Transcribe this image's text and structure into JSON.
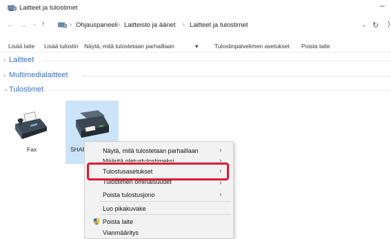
{
  "window": {
    "title": "Laitteet ja tulostimet",
    "minimize_glyph": "–"
  },
  "address": {
    "nav_back": "←",
    "nav_forward": "→",
    "nav_recent": "⌄",
    "nav_up": "↑",
    "breadcrumbs": [
      "Ohjauspaneeli",
      "Laitteisto ja äänet",
      "Laitteet ja tulostimet"
    ],
    "separator": "›",
    "dropdown_glyph": "⌄",
    "refresh_glyph": "↻",
    "right_glyph": "⟩"
  },
  "toolbar": {
    "add_device": "Lisää laite",
    "add_printer": "Lisää tulostin",
    "see_printing": "Näytä, mitä tulostetaan parhaillaan",
    "see_printing_arrow": "▾",
    "print_server": "Tulostinpalvelimen asetukset",
    "remove_device": "Poista laite"
  },
  "groups": {
    "devices": "Laitteet",
    "multimedia": "Multimedialaitteet",
    "printers": "Tulostimet",
    "collapsed_chevron": "›",
    "expanded_chevron": "⌄"
  },
  "devices": {
    "fax_label": "Fax",
    "sharp_label": "SHARP"
  },
  "context_menu": {
    "items": [
      {
        "label": "Näytä, mitä tulostetaan parhaillaan",
        "submenu": true
      },
      {
        "label": "Määritä oletustulostimeksi",
        "submenu": true
      },
      {
        "label": "Tulostusasetukset",
        "submenu": true
      },
      {
        "label": "Tulostimen ominaisuudet",
        "submenu": true
      },
      {
        "label": "Poista tulostusjono",
        "submenu": true
      },
      {
        "label": "Luo pikakuvake",
        "submenu": false
      },
      {
        "label": "Poista laite",
        "submenu": false
      },
      {
        "label": "Vianmääritys",
        "submenu": false
      }
    ],
    "submenu_arrow": "›"
  },
  "colors": {
    "group_label": "#3b6fb6",
    "selection": "#cce4f7",
    "highlight_border": "#e0152e"
  }
}
